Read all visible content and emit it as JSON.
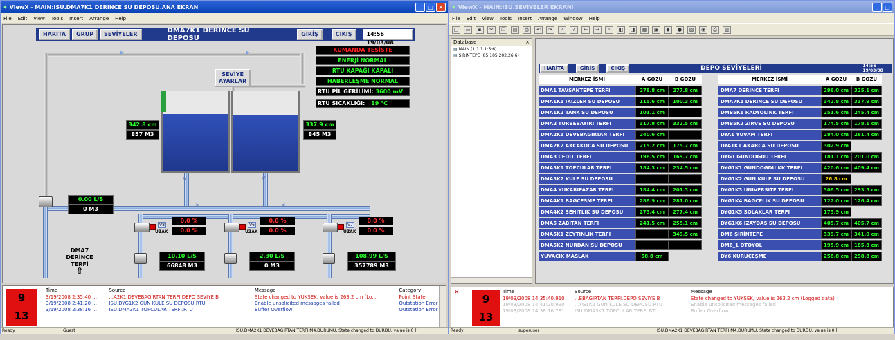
{
  "left_window": {
    "title": "ViewX - MAIN:ISU.DMA7K1 DERINCE SU DEPOSU.ANA EKRAN",
    "menu": [
      "File",
      "Edit",
      "View",
      "Tools",
      "Insert",
      "Arrange",
      "Help"
    ],
    "nav_buttons": [
      "HARİTA",
      "GRUP",
      "SEVİYELER"
    ],
    "screen_title": "DMA7K1 DERINCE SU DEPOSU",
    "login_button": "GİRİŞ",
    "logout_button": "ÇIKIŞ",
    "clock": "14:56 19/03/08",
    "status": {
      "kumanda": "KUMANDA TESİSTE",
      "enerji": "ENERJİ NORMAL",
      "rtu_kapak": "RTU KAPAĞI KAPALI",
      "haberlesme": "HABERLEŞME NORMAL",
      "pil_label": "RTU PİL GERİLİMİ:",
      "pil_value": "3600 mV",
      "sicaklik_label": "RTU SICAKLIĞI:",
      "sicaklik_value": "19 °C"
    },
    "seviye_button": [
      "SEVİYE",
      "AYARLAR"
    ],
    "tank_a_level": "342.8 cm",
    "tank_a_volume": "857 M3",
    "tank_b_level": "337.9 cm",
    "tank_b_volume": "845 M3",
    "inlet_flow": "0.00 L/S",
    "inlet_total": "0 M3",
    "valves": [
      {
        "tag": "V8",
        "mode": "UZAK",
        "pct1": "0.0 %",
        "pct2": "0.0 %"
      },
      {
        "tag": "V6",
        "mode": "UZAK",
        "pct1": "0.0 %",
        "pct2": "0.0 %"
      },
      {
        "tag": "V7",
        "mode": "UZAK",
        "pct1": "0.0 %",
        "pct2": "0.0 %"
      }
    ],
    "outlets": [
      {
        "flow": "10.10 L/S",
        "total": "66848 M3"
      },
      {
        "flow": "2.30 L/S",
        "total": "0 M3"
      },
      {
        "flow": "108.99 L/S",
        "total": "357789 M3"
      }
    ],
    "dma_label": [
      "DMA7",
      "DERİNCE",
      "TERFİ"
    ],
    "alarm_counts": {
      "top": "9",
      "bottom": "13"
    },
    "event_headers": [
      "Time",
      "Source",
      "Message",
      "Category"
    ],
    "events": [
      {
        "time": "3/19/2008 2:35:40 ...",
        "source": "...A2K1 DEVEBAGIRTAN TERFI.DEPO SEVIYE B",
        "message": "State changed to YUKSEK, value is 263.2 cm (Lo...",
        "category": "Point State",
        "color": "#d01010"
      },
      {
        "time": "3/19/2008 2:41:20 ...",
        "source": "ISU.DYG1K2 GUN KULE SU DEPOSU.RTU",
        "message": "Enable unsolicited messages failed",
        "category": "Outstation Error",
        "color": "#1a3aa8"
      },
      {
        "time": "3/19/2008 2:38:16 ...",
        "source": "ISU.DMA3K1 TOPCULAR TERFI.RTU",
        "message": "Buffer Overflow",
        "category": "Outstation Error",
        "color": "#1a3aa8"
      }
    ],
    "statusbar": {
      "ready": "Ready",
      "user": "Guest",
      "message": "ISU.DMA2K1 DEVEBAGIRTAN TERFI.M4.DURUMU, State changed to DURDU, value is 0 ("
    }
  },
  "right_window": {
    "title": "ViewX - MAIN:ISU.SEVIYELER EKRANI",
    "menu": [
      "File",
      "Edit",
      "View",
      "Tools",
      "Insert",
      "Arrange",
      "Window",
      "Help"
    ],
    "database_label": "Database",
    "database_items": [
      "MAIN (1.1.1.1:5:6)",
      "SIRINTEPE (85.105.202.26:6)"
    ],
    "nav_buttons": [
      "HARİTA",
      "GİRİŞ",
      "ÇIKIŞ"
    ],
    "screen_title": "DEPO SEVİYELERİ",
    "clock": "14:56 19/03/08",
    "col_headers": [
      "MERKEZ İSMİ",
      "A GOZU",
      "B GOZU",
      "MERKEZ İSMİ",
      "A GOZU",
      "B GOZU"
    ],
    "rows_left": [
      {
        "name": "DMA1 TAVSANTEPE TERFI",
        "a": "278.8 cm",
        "b": "277.8 cm"
      },
      {
        "name": "DMA1K1 IKIZLER SU DEPOSU",
        "a": "115.6 cm",
        "b": "100.3 cm"
      },
      {
        "name": "DMA1K2 TANK SU DEPOSU",
        "a": "101.1 cm",
        "b": ""
      },
      {
        "name": "DMA2 TURBEBAYIRI TERFI",
        "a": "317.8 cm",
        "b": "332.5 cm"
      },
      {
        "name": "DMA2K1 DEVEBAGIRTAN TERFI",
        "a": "240.6 cm",
        "b": ""
      },
      {
        "name": "DMA2K2 AKCAKOCA SU DEPOSU",
        "a": "215.2 cm",
        "b": "175.7 cm"
      },
      {
        "name": "DMA3 CEDIT TERFI",
        "a": "196.5 cm",
        "b": "169.7 cm"
      },
      {
        "name": "DMA3K1 TOPCULAR TERFI",
        "a": "184.3 cm",
        "b": "234.5 cm"
      },
      {
        "name": "DMA3K2 KULE SU DEPOSU",
        "a": "",
        "b": ""
      },
      {
        "name": "DMA4 YUKARIPAZAR TERFI",
        "a": "184.4 cm",
        "b": "201.3 cm"
      },
      {
        "name": "DMA4K1 BAGCESME TERFI",
        "a": "288.9 cm",
        "b": "281.0 cm"
      },
      {
        "name": "DMA4K2 SEHITLIK SU DEPOSU",
        "a": "275.4 cm",
        "b": "277.4 cm"
      },
      {
        "name": "DMA5 ZABITAN TERFI",
        "a": "241.5 cm",
        "b": "255.1 cm"
      },
      {
        "name": "DMA5K1 ZEYTINLIK TERFI",
        "a": "",
        "b": "349.5 cm"
      },
      {
        "name": "DMA5K2 NURDAN SU DEPOSU",
        "a": "",
        "b": ""
      },
      {
        "name": "YUVACIK MASLAK",
        "a": "58.8 cm",
        "b": null
      }
    ],
    "rows_right": [
      {
        "name": "DMA7 DERINCE TERFI",
        "a": "296.0 cm",
        "b": "325.1 cm",
        "ay": false
      },
      {
        "name": "DMA7K1 DERINCE SU DEPOSU",
        "a": "342.8 cm",
        "b": "337.9 cm",
        "ay": false
      },
      {
        "name": "DMB5K1 RADYOLINK TERFI",
        "a": "251.6 cm",
        "b": "245.4 cm",
        "ay": false
      },
      {
        "name": "DMB5K2 ZIRVE SU DEPOSU",
        "a": "174.5 cm",
        "b": "178.1 cm",
        "ay": false
      },
      {
        "name": "DYA1 YUVAM TERFI",
        "a": "284.0 cm",
        "b": "281.4 cm",
        "ay": false
      },
      {
        "name": "DYA1K1 AKARCA SU DEPOSU",
        "a": "302.9 cm",
        "b": null,
        "ay": false
      },
      {
        "name": "DYG1 GUNDOGDU TERFI",
        "a": "181.1 cm",
        "b": "201.0 cm",
        "ay": false
      },
      {
        "name": "DYG1K1 GUNDOGDU KK TERFI",
        "a": "420.6 cm",
        "b": "409.4 cm",
        "ay": false
      },
      {
        "name": "DYG1K2 GUN KULE SU DEPOSU",
        "a": "26.8 cm",
        "b": null,
        "ay": true
      },
      {
        "name": "DYG1K3 UNIVERSITE TERFI",
        "a": "308.5 cm",
        "b": "293.5 cm",
        "ay": false
      },
      {
        "name": "DYG1K4 BAGCELIK SU DEPOSU",
        "a": "122.0 cm",
        "b": "126.4 cm",
        "ay": false
      },
      {
        "name": "DYG1K5 SOLAKLAR TERFI",
        "a": "175.9 cm",
        "b": null,
        "ay": false
      },
      {
        "name": "DYG1K6 IZAYDAS SU DEPOSU",
        "a": "405.7 cm",
        "b": "405.7 cm",
        "ay": false
      },
      {
        "name": "DM6 ŞİRİNTEPE",
        "a": "339.7 cm",
        "b": "341.0 cm",
        "ay": false
      },
      {
        "name": "DM6_1 OTOYOL",
        "a": "195.9 cm",
        "b": "185.8 cm",
        "ay": false
      },
      {
        "name": "DY6 KURUÇEŞME",
        "a": "258.8 cm",
        "b": "258.8 cm",
        "ay": false
      }
    ],
    "alarm_counts": {
      "top": "9",
      "bottom": "13"
    },
    "event_headers": [
      "Time",
      "Source",
      "Message"
    ],
    "events": [
      {
        "time": "19/03/2008 14:35:40.910",
        "source": "...EBAGIRTAN TERFI.DEPO SEVIYE B",
        "message": "State changed to YUKSEK, value is 263.2 cm (Logged data)",
        "color": "#d01010"
      },
      {
        "time": "19/03/2008 14:41:20.990",
        "source": "...YG1K2 GUN KULE SU DEPOSU.RTU",
        "message": "Enable unsolicited messages failed",
        "color": "#b8b8b8"
      },
      {
        "time": "19/03/2008 14:38:16.781",
        "source": "ISU.DMA3K1 TOPCULAR TERFI.RTU",
        "message": "Buffer Overflow",
        "color": "#b8b8b8"
      }
    ],
    "statusbar": {
      "ready": "Ready",
      "user": "superuser",
      "message": "ISU.DMA2K1 DEVEBAGIRTAN TERFI.M4.DURUMU, State changed to DURDU, value is 0 ("
    }
  }
}
